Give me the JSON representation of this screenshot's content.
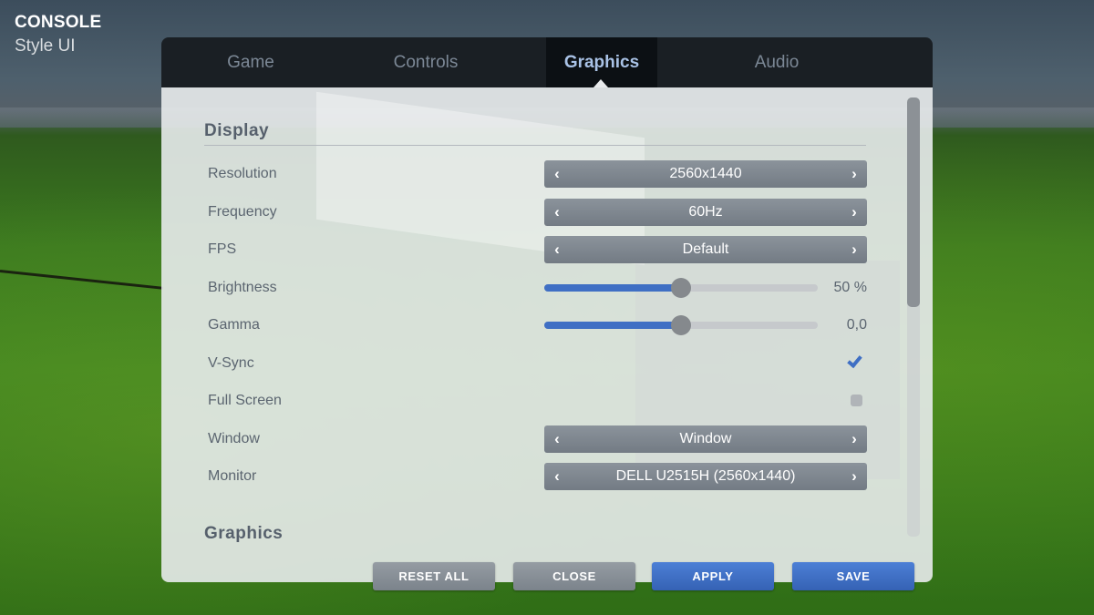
{
  "brand": {
    "title": "CONSOLE",
    "subtitle": "Style UI"
  },
  "tabs": [
    {
      "label": "Game",
      "active": false
    },
    {
      "label": "Controls",
      "active": false
    },
    {
      "label": "Graphics",
      "active": true
    },
    {
      "label": "Audio",
      "active": false
    }
  ],
  "sections": {
    "display": "Display",
    "graphics": "Graphics"
  },
  "settings": {
    "resolution": {
      "label": "Resolution",
      "value": "2560x1440"
    },
    "frequency": {
      "label": "Frequency",
      "value": "60Hz"
    },
    "fps": {
      "label": "FPS",
      "value": "Default"
    },
    "brightness": {
      "label": "Brightness",
      "value_text": "50 %",
      "level": 0.5
    },
    "gamma": {
      "label": "Gamma",
      "value_text": "0,0",
      "level": 0.5
    },
    "vsync": {
      "label": "V-Sync",
      "checked": true
    },
    "fullscreen": {
      "label": "Full Screen",
      "checked": false
    },
    "window": {
      "label": "Window",
      "value": "Window"
    },
    "monitor": {
      "label": "Monitor",
      "value": "DELL U2515H (2560x1440)"
    }
  },
  "icons": {
    "left_arrow": "‹",
    "right_arrow": "›"
  },
  "buttons": {
    "reset_all": "RESET ALL",
    "close": "CLOSE",
    "apply": "APPLY",
    "save": "SAVE"
  },
  "colors": {
    "accent": "#3f6fc4",
    "tab_active_text": "#a9c2e6",
    "tab_bar": "#1a1f24"
  }
}
